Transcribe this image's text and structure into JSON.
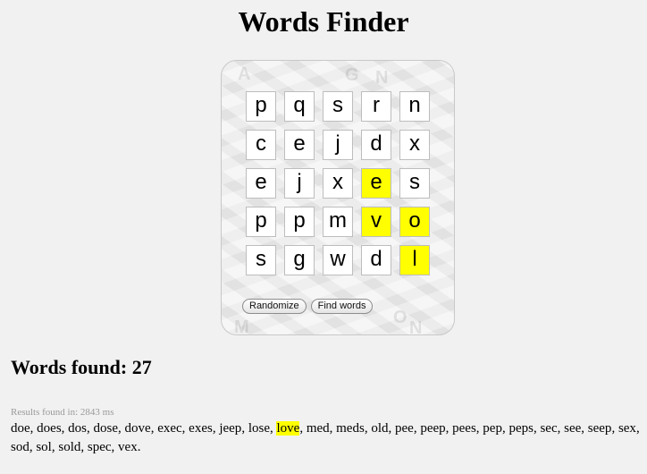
{
  "page": {
    "title": "Words Finder"
  },
  "board": {
    "rows": [
      [
        {
          "letter": "p",
          "hl": false
        },
        {
          "letter": "q",
          "hl": false
        },
        {
          "letter": "s",
          "hl": false
        },
        {
          "letter": "r",
          "hl": false
        },
        {
          "letter": "n",
          "hl": false
        }
      ],
      [
        {
          "letter": "c",
          "hl": false
        },
        {
          "letter": "e",
          "hl": false
        },
        {
          "letter": "j",
          "hl": false
        },
        {
          "letter": "d",
          "hl": false
        },
        {
          "letter": "x",
          "hl": false
        }
      ],
      [
        {
          "letter": "e",
          "hl": false
        },
        {
          "letter": "j",
          "hl": false
        },
        {
          "letter": "x",
          "hl": false
        },
        {
          "letter": "e",
          "hl": true
        },
        {
          "letter": "s",
          "hl": false
        }
      ],
      [
        {
          "letter": "p",
          "hl": false
        },
        {
          "letter": "p",
          "hl": false
        },
        {
          "letter": "m",
          "hl": false
        },
        {
          "letter": "v",
          "hl": true
        },
        {
          "letter": "o",
          "hl": true
        }
      ],
      [
        {
          "letter": "s",
          "hl": false
        },
        {
          "letter": "g",
          "hl": false
        },
        {
          "letter": "w",
          "hl": false
        },
        {
          "letter": "d",
          "hl": false
        },
        {
          "letter": "l",
          "hl": true
        }
      ]
    ],
    "highlight_color": "#ffff00",
    "randomize_label": "Randomize",
    "find_words_label": "Find words"
  },
  "results": {
    "heading": "Words found: 27",
    "timing": "Results found in: 2843 ms",
    "highlighted_word": "love",
    "words": [
      "doe",
      "does",
      "dos",
      "dose",
      "dove",
      "exec",
      "exes",
      "jeep",
      "lose",
      "love",
      "med",
      "meds",
      "old",
      "pee",
      "peep",
      "pees",
      "pep",
      "peps",
      "sec",
      "see",
      "seep",
      "sex",
      "sod",
      "sol",
      "sold",
      "spec",
      "vex"
    ]
  }
}
